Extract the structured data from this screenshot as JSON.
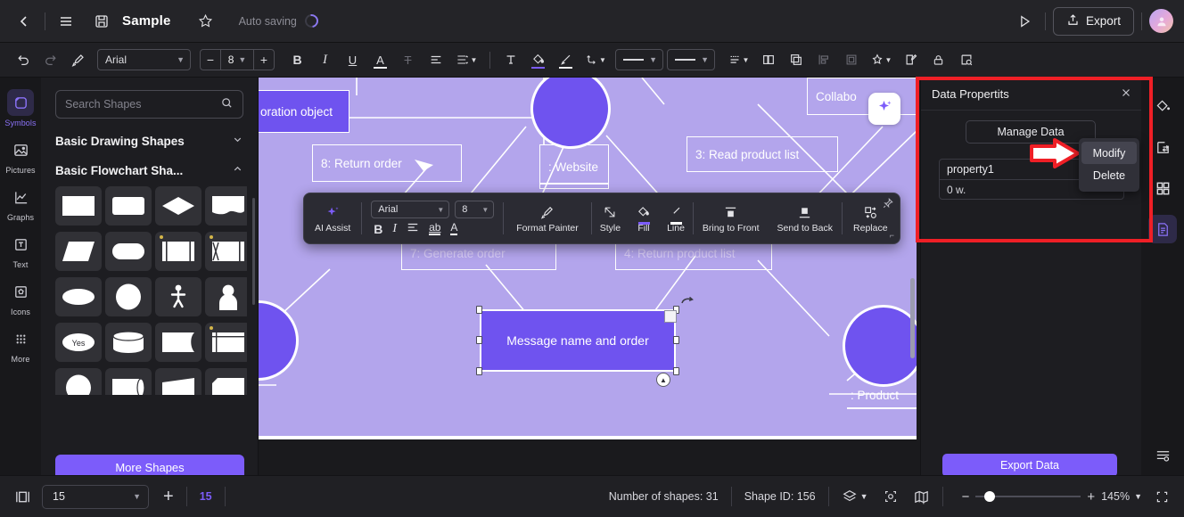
{
  "titlebar": {
    "back_icon": "chevron-left-icon",
    "menu_icon": "hamburger-menu-icon",
    "save_icon": "floppy-save-icon",
    "title": "Sample",
    "star_icon": "star-icon",
    "autosave_label": "Auto saving",
    "present_icon": "play-present-icon",
    "export_label": "Export",
    "export_icon": "share-upload-icon",
    "avatar_icon": "user-avatar"
  },
  "toolbar": {
    "undo_icon": "undo-icon",
    "redo_icon": "redo-icon",
    "format_painter_icon": "format-painter-icon",
    "font_family": "Arial",
    "font_size": "8",
    "minus_label": "−",
    "plus_label": "+",
    "bold_label": "B",
    "italic_label": "I",
    "underline_label": "U",
    "font_color_label": "A",
    "strikethrough_label": "T",
    "align_icon": "align-left-icon",
    "line_spacing_icon": "line-spacing-icon",
    "text_box_icon": "text-box-icon",
    "fill_icon": "fill-bucket-icon",
    "line_icon": "line-pen-icon",
    "connector_icon": "connector-icon",
    "line_weight_placeholder": "line-weight-select",
    "line_style_placeholder": "line-style-select",
    "line_type_icon": "line-type-icon",
    "duplicate_icon": "duplicate-icon",
    "copy_icon": "copy-icon",
    "align_objects_icon": "align-objects-icon",
    "group_icon": "group-icon",
    "effects_icon": "effects-icon",
    "comment_icon": "edit-comment-icon",
    "lock_icon": "lock-icon",
    "find_icon": "find-replace-icon"
  },
  "left_rail": {
    "items": [
      {
        "label": "Symbols",
        "icon": "symbols-icon",
        "active": true
      },
      {
        "label": "Pictures",
        "icon": "pictures-icon",
        "active": false
      },
      {
        "label": "Graphs",
        "icon": "graphs-icon",
        "active": false
      },
      {
        "label": "Text",
        "icon": "text-icon",
        "active": false
      },
      {
        "label": "Icons",
        "icon": "icons-icon",
        "active": false
      },
      {
        "label": "More",
        "icon": "more-grid-icon",
        "active": false
      }
    ]
  },
  "shape_panel": {
    "search_placeholder": "Search Shapes",
    "search_icon": "search-icon",
    "groups": [
      {
        "title": "Basic Drawing Shapes",
        "expanded": false,
        "chevron": "chevron-down-icon"
      },
      {
        "title": "Basic Flowchart Sha...",
        "expanded": true,
        "chevron": "chevron-up-icon"
      }
    ],
    "shape_yes_label": "Yes",
    "more_shapes_label": "More Shapes"
  },
  "canvas": {
    "nodes": [
      {
        "text": "oration object",
        "filled": true
      },
      {
        "text": "8: Return order",
        "filled": false
      },
      {
        "text": ": Website",
        "filled": false
      },
      {
        "text": "3: Read product list",
        "filled": false
      },
      {
        "text": "Collabo",
        "filled": false
      },
      {
        "text": "7: Generate order",
        "filled": false
      },
      {
        "text": "4: Return product list",
        "filled": false
      },
      {
        "text": ": Product",
        "filled": false
      }
    ],
    "selected_shape_text": "Message name and order",
    "ai_bubble_icon": "ai-sparkle-icon",
    "rotate_icon": "rotate-handle-icon",
    "shape_menu_icon": "shape-menu-icon"
  },
  "context_toolbar": {
    "ai_assist_label": "AI Assist",
    "ai_assist_icon": "ai-sparkle-icon",
    "font_family": "Arial",
    "font_size": "8",
    "bold_label": "B",
    "italic_label": "I",
    "align_icon": "align-icon",
    "underline_ab_label": "ab",
    "font_color_label": "A",
    "format_painter_label": "Format Painter",
    "format_painter_icon": "format-painter-icon",
    "style_label": "Style",
    "style_icon": "style-icon",
    "fill_label": "Fill",
    "fill_icon": "fill-bucket-icon",
    "line_label": "Line",
    "line_icon": "line-pen-icon",
    "bring_front_label": "Bring to Front",
    "bring_front_icon": "bring-to-front-icon",
    "send_back_label": "Send to Back",
    "send_back_icon": "send-to-back-icon",
    "replace_label": "Replace",
    "replace_icon": "replace-icon",
    "pin_icon": "pin-icon"
  },
  "data_panel": {
    "title": "Data Propertits",
    "close_icon": "close-icon",
    "manage_data_label": "Manage Data",
    "property_name": "property1",
    "property_value": "0 w.",
    "export_data_label": "Export Data"
  },
  "context_menu": {
    "items": [
      {
        "label": "Modify",
        "highlighted": true
      },
      {
        "label": "Delete",
        "highlighted": false
      }
    ]
  },
  "right_rail": {
    "items": [
      {
        "icon": "fill-bucket-icon",
        "active": false
      },
      {
        "icon": "swap-panel-icon",
        "active": false
      },
      {
        "icon": "grid-apps-icon",
        "active": false
      },
      {
        "icon": "data-document-icon",
        "active": true
      }
    ],
    "bottom_icon": "settings-list-icon"
  },
  "status_bar": {
    "panel_toggle_icon": "panel-toggle-icon",
    "page_value": "15",
    "page_chevron": "chevron-down-icon",
    "add_page_label": "+",
    "page_count": "15",
    "shapes_label": "Number of shapes: 31",
    "shape_id_label": "Shape ID: 156",
    "layers_icon": "layers-icon",
    "focus_icon": "focus-icon",
    "map_icon": "map-icon",
    "zoom_minus": "−",
    "zoom_plus": "+",
    "zoom_level": "145%",
    "zoom_chevron": "chevron-down-icon",
    "fullscreen_icon": "fullscreen-icon"
  },
  "colors": {
    "accent": "#7c5cfa",
    "canvas_bg": "#b3a5ec",
    "node_fill": "#6f53ef",
    "annotation_red": "#ef1f26"
  }
}
